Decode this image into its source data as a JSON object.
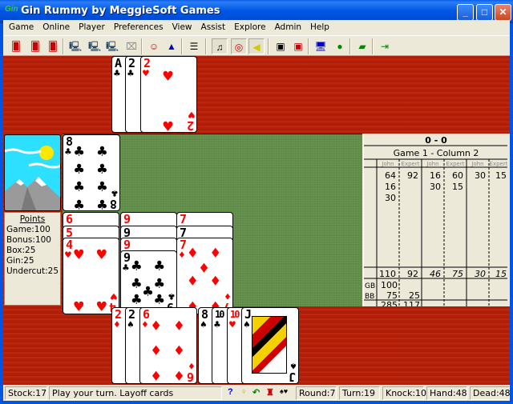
{
  "window": {
    "title": "Gin Rummy by MeggieSoft Games",
    "app_icon": "gin-icon",
    "app_icon_text": "Gin",
    "minimize": "_",
    "maximize": "□",
    "close": "✕"
  },
  "menu": [
    "Game",
    "Online",
    "Player",
    "Preferences",
    "View",
    "Assist",
    "Explore",
    "Admin",
    "Help"
  ],
  "toolbar": {
    "buttons": [
      {
        "name": "new-game-icon",
        "glyph": "🂠"
      },
      {
        "name": "deal-icon",
        "glyph": "🂠"
      },
      {
        "name": "undo-card-icon",
        "glyph": "🂠"
      },
      {
        "name": "connect-icon",
        "glyph": "🖳"
      },
      {
        "name": "network-play-icon",
        "glyph": "🖳"
      },
      {
        "name": "network-query-icon",
        "glyph": "🖳"
      },
      {
        "name": "disconnect-icon",
        "glyph": "⌧"
      },
      {
        "name": "switch-player-icon",
        "glyph": "☺"
      },
      {
        "name": "wizard-icon",
        "glyph": "▲"
      },
      {
        "name": "scoresheet-icon",
        "glyph": "☰"
      },
      {
        "name": "music-icon",
        "glyph": "♫"
      },
      {
        "name": "speech-icon",
        "glyph": "◎"
      },
      {
        "name": "sound-icon",
        "glyph": "◀"
      },
      {
        "name": "chat-icon",
        "glyph": "▣"
      },
      {
        "name": "chat-off-icon",
        "glyph": "▣"
      },
      {
        "name": "internet-icon",
        "glyph": "🖥"
      },
      {
        "name": "globe-icon",
        "glyph": "●"
      },
      {
        "name": "help-book-icon",
        "glyph": "▰"
      },
      {
        "name": "exit-icon",
        "glyph": "⇥"
      }
    ]
  },
  "opponent_hand": [
    {
      "rank": "A",
      "suit": "♣",
      "color": "black"
    },
    {
      "rank": "2",
      "suit": "♣",
      "color": "black"
    },
    {
      "rank": "2",
      "suit": "♥",
      "color": "red"
    }
  ],
  "discard_top": {
    "rank": "8",
    "suit": "♣",
    "color": "black"
  },
  "melds": [
    [
      {
        "rank": "6",
        "suit": "♥"
      },
      {
        "rank": "5",
        "suit": "♥"
      },
      {
        "rank": "4",
        "suit": "♥"
      }
    ],
    [
      {
        "rank": "9",
        "suit": "♥"
      },
      {
        "rank": "9",
        "suit": "♠"
      },
      {
        "rank": "9",
        "suit": "♦"
      },
      {
        "rank": "9",
        "suit": "♣"
      }
    ],
    [
      {
        "rank": "7",
        "suit": "♥"
      },
      {
        "rank": "7",
        "suit": "♠"
      },
      {
        "rank": "7",
        "suit": "♦"
      }
    ]
  ],
  "player_hand": [
    {
      "rank": "2",
      "suit": "♦",
      "color": "red"
    },
    {
      "rank": "2",
      "suit": "♠",
      "color": "black"
    },
    {
      "rank": "6",
      "suit": "♦",
      "color": "red"
    },
    {
      "rank": "8",
      "suit": "♠",
      "color": "black"
    },
    {
      "rank": "10",
      "suit": "♣",
      "color": "black"
    },
    {
      "rank": "10",
      "suit": "♥",
      "color": "red"
    },
    {
      "rank": "J",
      "suit": "♠",
      "color": "black"
    }
  ],
  "points": {
    "heading": "Points",
    "lines": [
      "Game:100",
      "Bonus:100",
      "Box:25",
      "Gin:25",
      "Undercut:25"
    ]
  },
  "scoresheet": {
    "match": "0 - 0",
    "subtitle": "Game 1 -  Column 2",
    "players": [
      "John",
      "Expert",
      "John",
      "Expert",
      "John",
      "Expert"
    ],
    "rows": [
      [
        "64",
        "92",
        "16",
        "60",
        "30",
        "15"
      ],
      [
        "16",
        "",
        "30",
        "15",
        "",
        ""
      ],
      [
        "30",
        "",
        "",
        "",
        "",
        ""
      ]
    ],
    "totals": [
      "110",
      "92",
      "46",
      "75",
      "30",
      "15"
    ],
    "gb_label": "GB",
    "gb": [
      "100",
      ""
    ],
    "bb_label": "BB",
    "bb": [
      "75",
      "25"
    ],
    "grand": [
      "285",
      "117"
    ]
  },
  "status": {
    "stock": "Stock:17",
    "message": "Play your turn.  Layoff cards",
    "icons": [
      {
        "name": "help-icon",
        "glyph": "?",
        "color": "#0000cc"
      },
      {
        "name": "hint-bulb-icon",
        "glyph": "♀",
        "color": "#c8b400"
      },
      {
        "name": "undo-icon",
        "glyph": "↶",
        "color": "#008000"
      },
      {
        "name": "castle-icon",
        "glyph": "♜",
        "color": "#cc0000"
      },
      {
        "name": "suits-icon",
        "glyph": "♠♥",
        "color": "#000"
      }
    ],
    "round": "Round:7",
    "turn": "Turn:19",
    "knock": "Knock:10",
    "hand": "Hand:48",
    "dead": "Dead:48"
  },
  "colors": {
    "felt_red": "#b8210a",
    "felt_green": "#5f8a48",
    "card_red": "#ff0000",
    "deck_sky": "#2ee0ff"
  }
}
